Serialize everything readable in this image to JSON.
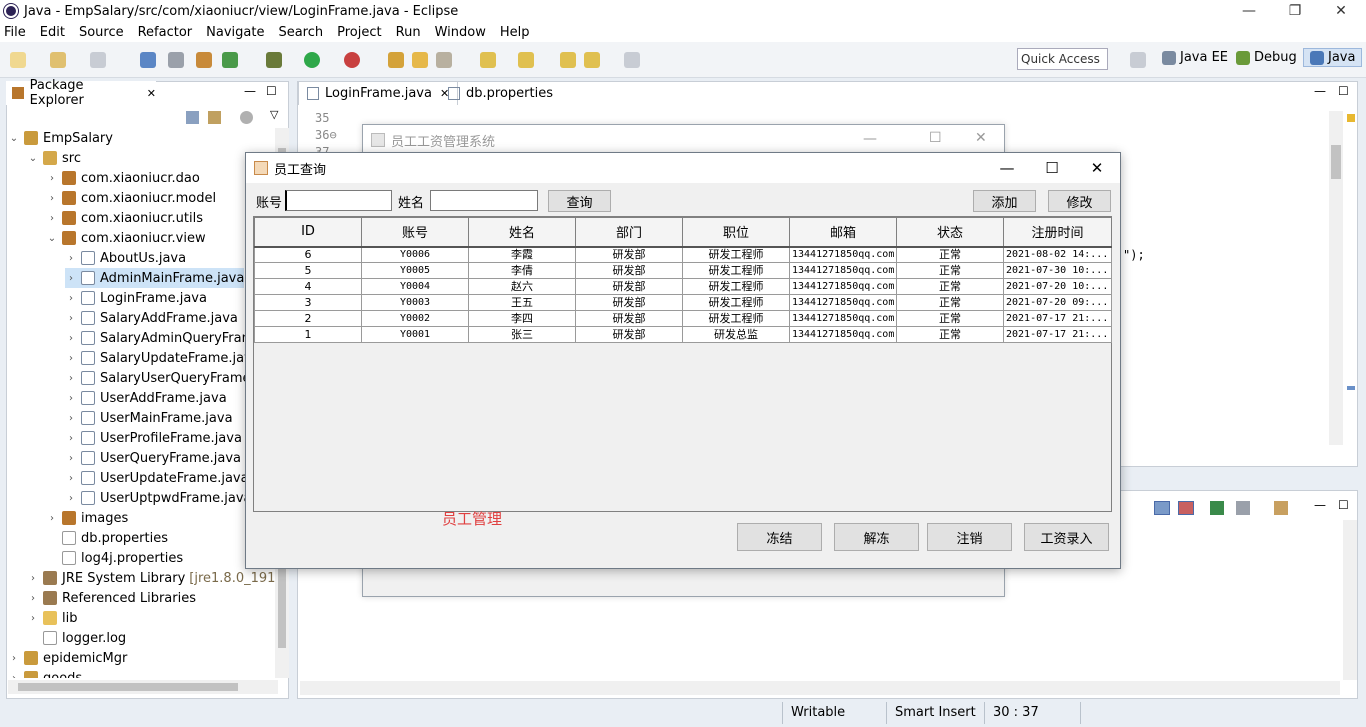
{
  "window": {
    "title": "Java - EmpSalary/src/com/xiaoniucr/view/LoginFrame.java - Eclipse",
    "minimize": "—",
    "restore": "❐",
    "close": "✕"
  },
  "menu": [
    "File",
    "Edit",
    "Source",
    "Refactor",
    "Navigate",
    "Search",
    "Project",
    "Run",
    "Window",
    "Help"
  ],
  "toolbar": {
    "quick_access": "Quick Access",
    "perspectives": [
      "Java EE",
      "Debug",
      "Java"
    ]
  },
  "package_explorer": {
    "tab_label": "Package Explorer",
    "tab_close": "✕",
    "tree": [
      {
        "label": "EmpSalary",
        "twisty": "⌄",
        "icon": "project-icon",
        "depth": 0
      },
      {
        "label": "src",
        "twisty": "⌄",
        "icon": "source-folder-icon",
        "depth": 1
      },
      {
        "label": "com.xiaoniucr.dao",
        "twisty": "›",
        "icon": "package-icon",
        "depth": 2
      },
      {
        "label": "com.xiaoniucr.model",
        "twisty": "›",
        "icon": "package-icon",
        "depth": 2
      },
      {
        "label": "com.xiaoniucr.utils",
        "twisty": "›",
        "icon": "package-icon",
        "depth": 2
      },
      {
        "label": "com.xiaoniucr.view",
        "twisty": "⌄",
        "icon": "package-icon",
        "depth": 2
      },
      {
        "label": "AboutUs.java",
        "twisty": "›",
        "icon": "java-file-icon",
        "depth": 3
      },
      {
        "label": "AdminMainFrame.java",
        "twisty": "›",
        "icon": "java-file-icon",
        "depth": 3,
        "selected": true
      },
      {
        "label": "LoginFrame.java",
        "twisty": "›",
        "icon": "java-file-icon",
        "depth": 3
      },
      {
        "label": "SalaryAddFrame.java",
        "twisty": "›",
        "icon": "java-file-icon",
        "depth": 3
      },
      {
        "label": "SalaryAdminQueryFrame",
        "twisty": "›",
        "icon": "java-file-icon",
        "depth": 3
      },
      {
        "label": "SalaryUpdateFrame.java",
        "twisty": "›",
        "icon": "java-file-icon",
        "depth": 3
      },
      {
        "label": "SalaryUserQueryFrame.j",
        "twisty": "›",
        "icon": "java-file-icon",
        "depth": 3
      },
      {
        "label": "UserAddFrame.java",
        "twisty": "›",
        "icon": "java-file-icon",
        "depth": 3
      },
      {
        "label": "UserMainFrame.java",
        "twisty": "›",
        "icon": "java-file-icon",
        "depth": 3
      },
      {
        "label": "UserProfileFrame.java",
        "twisty": "›",
        "icon": "java-file-icon",
        "depth": 3
      },
      {
        "label": "UserQueryFrame.java",
        "twisty": "›",
        "icon": "java-file-icon",
        "depth": 3
      },
      {
        "label": "UserUpdateFrame.java",
        "twisty": "›",
        "icon": "java-file-icon",
        "depth": 3
      },
      {
        "label": "UserUptpwdFrame.java",
        "twisty": "›",
        "icon": "java-file-icon",
        "depth": 3
      },
      {
        "label": "images",
        "twisty": "›",
        "icon": "package-icon",
        "depth": 2
      },
      {
        "label": "db.properties",
        "twisty": "",
        "icon": "file-icon",
        "depth": 2
      },
      {
        "label": "log4j.properties",
        "twisty": "",
        "icon": "file-icon",
        "depth": 2
      },
      {
        "label": "JRE System Library",
        "suffix": "[jre1.8.0_191]",
        "twisty": "›",
        "icon": "library-icon",
        "depth": 1
      },
      {
        "label": "Referenced Libraries",
        "twisty": "›",
        "icon": "library-icon",
        "depth": 1
      },
      {
        "label": "lib",
        "twisty": "›",
        "icon": "folder-icon",
        "depth": 1
      },
      {
        "label": "logger.log",
        "twisty": "",
        "icon": "file-icon",
        "depth": 1
      },
      {
        "label": "epidemicMgr",
        "twisty": "›",
        "icon": "project-icon",
        "depth": 0
      },
      {
        "label": "goods",
        "twisty": "›",
        "icon": "project-icon",
        "depth": 0
      }
    ]
  },
  "editor": {
    "tabs": [
      {
        "label": "LoginFrame.java",
        "close": "✕",
        "active": true
      },
      {
        "label": "db.properties",
        "active": false
      }
    ],
    "line_numbers": [
      "35",
      "36⊖",
      "37"
    ],
    "code_fragment": "\");"
  },
  "status_bar": {
    "writable": "Writable",
    "insert_mode": "Smart Insert",
    "position": "30 : 37"
  },
  "bg_window": {
    "title": "员工工资管理系统",
    "minimize": "—",
    "maximize": "☐",
    "close": "✕"
  },
  "query_window": {
    "title": "员工查询",
    "minimize": "—",
    "maximize": "☐",
    "close": "✕",
    "account_label": "账号",
    "account_value": "",
    "name_label": "姓名",
    "name_value": "",
    "query_button": "查询",
    "add_button": "添加",
    "edit_button": "修改",
    "columns": [
      "ID",
      "账号",
      "姓名",
      "部门",
      "职位",
      "邮箱",
      "状态",
      "注册时间"
    ],
    "rows": [
      [
        "6",
        "Y0006",
        "李霞",
        "研发部",
        "研发工程师",
        "13441271850qq.com",
        "正常",
        "2021-08-02 14:..."
      ],
      [
        "5",
        "Y0005",
        "李倩",
        "研发部",
        "研发工程师",
        "13441271850qq.com",
        "正常",
        "2021-07-30 10:..."
      ],
      [
        "4",
        "Y0004",
        "赵六",
        "研发部",
        "研发工程师",
        "13441271850qq.com",
        "正常",
        "2021-07-20 10:..."
      ],
      [
        "3",
        "Y0003",
        "王五",
        "研发部",
        "研发工程师",
        "13441271850qq.com",
        "正常",
        "2021-07-20 09:..."
      ],
      [
        "2",
        "Y0002",
        "李四",
        "研发部",
        "研发工程师",
        "13441271850qq.com",
        "正常",
        "2021-07-17 21:..."
      ],
      [
        "1",
        "Y0001",
        "张三",
        "研发部",
        "研发总监",
        "13441271850qq.com",
        "正常",
        "2021-07-17 21:..."
      ]
    ],
    "watermark": "员工管理",
    "freeze_button": "冻结",
    "unfreeze_button": "解冻",
    "cancel_button": "注销",
    "salary_entry_button": "工资录入"
  },
  "colors": {
    "watermark": "#e04040",
    "selection": "#cde3f7",
    "ide_background": "#e9eef4"
  }
}
